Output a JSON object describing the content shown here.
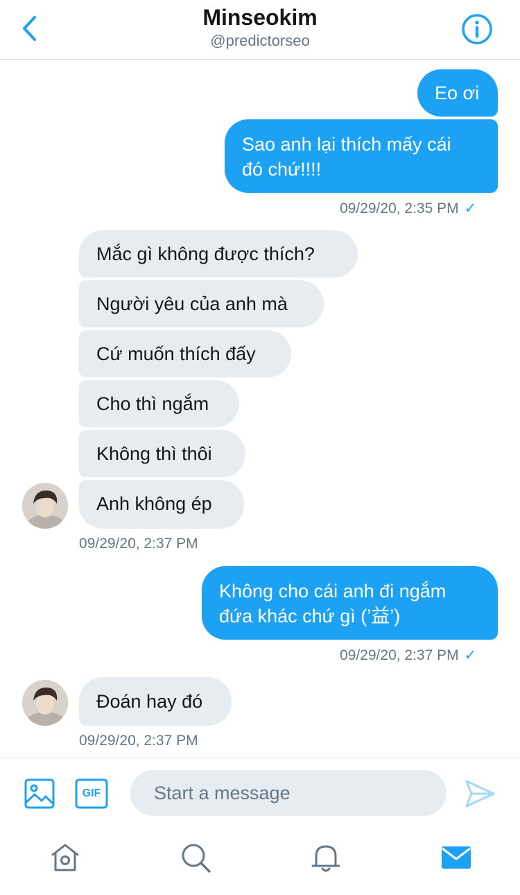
{
  "header": {
    "title": "Minseokim",
    "handle": "@predictorseo",
    "back_icon": "chevron-left-icon",
    "info_icon": "info-icon"
  },
  "colors": {
    "accent": "#1da1f2",
    "incoming_bubble": "#e6ecf0",
    "muted_text": "#657786"
  },
  "messages": [
    {
      "direction": "outgoing",
      "text": "Eo ơi"
    },
    {
      "direction": "outgoing",
      "lines": [
        "Sao anh lại thích mấy cái",
        "đó chứ!!!!"
      ]
    },
    {
      "direction": "incoming",
      "text": "Mắc gì không được thích?"
    },
    {
      "direction": "incoming",
      "text": "Người yêu của anh mà"
    },
    {
      "direction": "incoming",
      "text": "Cứ muốn thích đấy"
    },
    {
      "direction": "incoming",
      "text": "Cho thì ngắm"
    },
    {
      "direction": "incoming",
      "text": "Không thì thôi"
    },
    {
      "direction": "incoming",
      "text": "Anh không ép"
    },
    {
      "direction": "outgoing",
      "lines": [
        "Không cho cái anh đi ngắm",
        "đứa khác chứ gì (’益’)"
      ]
    },
    {
      "direction": "incoming",
      "text": "Đoán hay đó"
    }
  ],
  "timestamps": [
    {
      "text": "09/29/20, 2:35 PM",
      "check": "✓"
    },
    {
      "text": "09/29/20, 2:37 PM"
    },
    {
      "text": "09/29/20, 2:37 PM",
      "check": "✓"
    },
    {
      "text": "09/29/20, 2:37 PM"
    }
  ],
  "composer": {
    "placeholder": "Start a message",
    "image_icon": "image-icon",
    "gif_label": "GIF",
    "send_icon": "send-icon"
  },
  "tabs": [
    {
      "name": "home",
      "icon": "home-icon"
    },
    {
      "name": "search",
      "icon": "search-icon"
    },
    {
      "name": "notifications",
      "icon": "bell-icon"
    },
    {
      "name": "messages",
      "icon": "mail-icon",
      "active": true
    }
  ]
}
